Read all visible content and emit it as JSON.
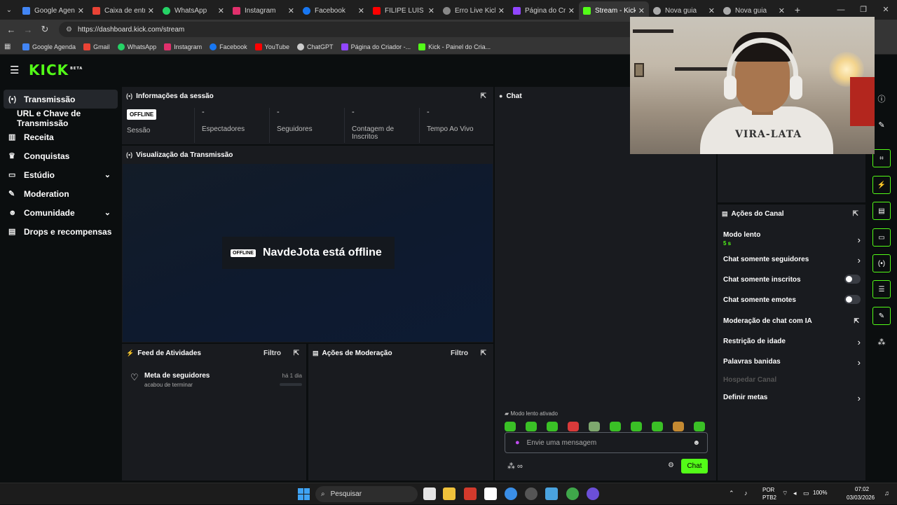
{
  "browser": {
    "tabs": [
      {
        "label": "Google Agenda",
        "color": "#4285f4"
      },
      {
        "label": "Caixa de entrada",
        "color": "#ea4335"
      },
      {
        "label": "WhatsApp",
        "color": "#25d366"
      },
      {
        "label": "Instagram",
        "color": "#e1306c"
      },
      {
        "label": "Facebook",
        "color": "#1877f2"
      },
      {
        "label": "FILIPE LUÍS FO",
        "color": "#ff0000"
      },
      {
        "label": "Erro Live Kick",
        "color": "#888888"
      },
      {
        "label": "Página do Cria",
        "color": "#9146ff"
      },
      {
        "label": "Stream - Kick",
        "color": "#53fc18"
      },
      {
        "label": "Nova guia",
        "color": "#aaaaaa"
      },
      {
        "label": "Nova guia",
        "color": "#aaaaaa"
      }
    ],
    "url": "https://dashboard.kick.com/stream",
    "bookmarks": [
      {
        "label": "Google Agenda",
        "color": "#4285f4"
      },
      {
        "label": "Gmail",
        "color": "#ea4335"
      },
      {
        "label": "WhatsApp",
        "color": "#25d366"
      },
      {
        "label": "Instagram",
        "color": "#e1306c"
      },
      {
        "label": "Facebook",
        "color": "#1877f2"
      },
      {
        "label": "YouTube",
        "color": "#ff0000"
      },
      {
        "label": "ChatGPT",
        "color": "#cccccc"
      },
      {
        "label": "Página do Criador -...",
        "color": "#9146ff"
      },
      {
        "label": "Kick - Painel do Cria...",
        "color": "#53fc18"
      }
    ]
  },
  "app": {
    "logo": "KICK",
    "logo_badge": "BETA",
    "accent": "#53fc18",
    "sidebar": [
      {
        "label": "Transmissão",
        "icon": "broadcast-icon"
      },
      {
        "label": "URL e Chave de Transmissão",
        "icon": ""
      },
      {
        "label": "Receita",
        "icon": "chart-icon"
      },
      {
        "label": "Conquistas",
        "icon": "trophy-icon"
      },
      {
        "label": "Estúdio",
        "icon": "studio-icon"
      },
      {
        "label": "Moderation",
        "icon": "wrench-icon"
      },
      {
        "label": "Comunidade",
        "icon": "users-icon"
      },
      {
        "label": "Drops e recompensas",
        "icon": "gift-icon"
      }
    ],
    "session": {
      "title": "Informações da sessão",
      "status_badge": "OFFLINE",
      "stats": [
        {
          "value": "",
          "label": "Sessão"
        },
        {
          "value": "-",
          "label": "Espectadores"
        },
        {
          "value": "-",
          "label": "Seguidores"
        },
        {
          "value": "-",
          "label": "Contagem de Inscritos"
        },
        {
          "value": "-",
          "label": "Tempo Ao Vivo"
        }
      ]
    },
    "preview": {
      "title": "Visualização da Transmissão",
      "badge": "OFFLINE",
      "message": "NavdeJota está offline"
    },
    "feed": {
      "title": "Feed de Atividades",
      "filter": "Filtro",
      "item_title": "Meta de seguidores",
      "item_sub": "acabou de terminar",
      "item_time": "há 1 dia"
    },
    "modactions": {
      "title": "Ações de Moderação",
      "filter": "Filtro"
    },
    "chat": {
      "title": "Chat",
      "slow_note": "Modo lento ativado",
      "placeholder": "Envie uma mensagem",
      "send_label": "Chat"
    },
    "channel_actions": {
      "title": "Ações do Canal",
      "items": [
        {
          "label": "Modo lento",
          "sub": "5 s"
        },
        {
          "label": "Chat somente seguidores"
        },
        {
          "label": "Chat somente inscritos"
        },
        {
          "label": "Chat somente emotes"
        },
        {
          "label": "Moderação de chat com IA"
        },
        {
          "label": "Restrição de idade"
        },
        {
          "label": "Palavras banidas"
        },
        {
          "label": "Hospedar Canal"
        },
        {
          "label": "Definir metas"
        }
      ]
    }
  },
  "webcam": {
    "shirt_text": "VIRA-LATA"
  },
  "taskbar": {
    "search": "Pesquisar",
    "lang": "POR",
    "lang_sub": "PTB2",
    "battery": "100%",
    "time": "07:02",
    "date": "03/03/2026"
  }
}
